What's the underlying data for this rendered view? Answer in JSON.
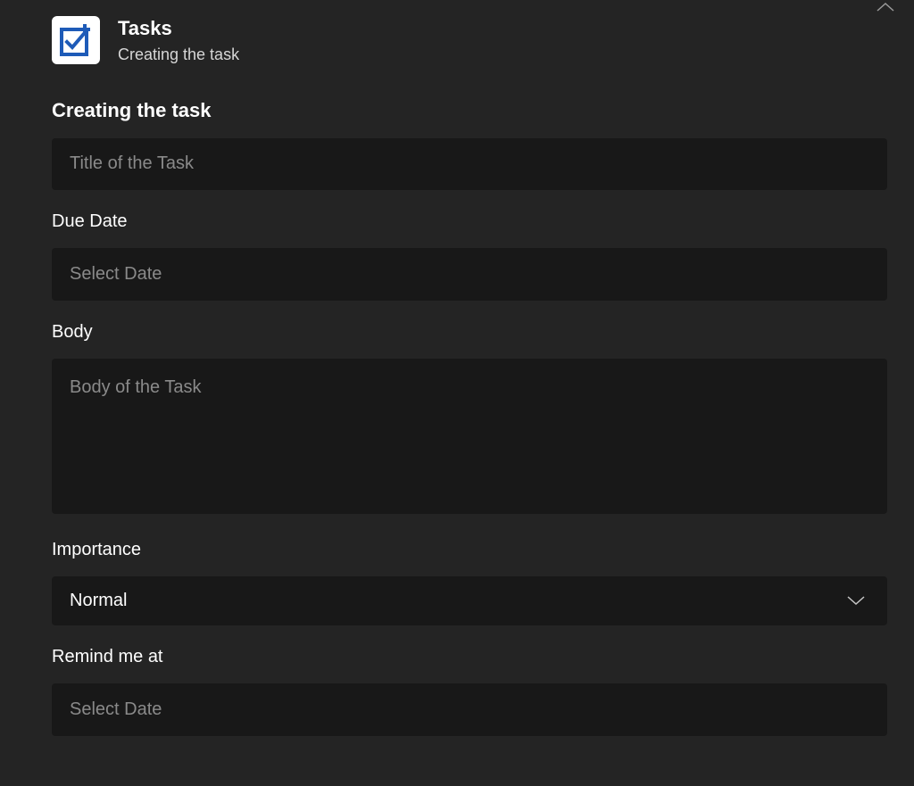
{
  "header": {
    "app_title": "Tasks",
    "app_subtitle": "Creating the task"
  },
  "form": {
    "heading": "Creating the task",
    "title": {
      "placeholder": "Title of the Task",
      "value": ""
    },
    "due_date": {
      "label": "Due Date",
      "placeholder": "Select Date",
      "value": ""
    },
    "body": {
      "label": "Body",
      "placeholder": "Body of the Task",
      "value": ""
    },
    "importance": {
      "label": "Importance",
      "selected": "Normal"
    },
    "remind_me": {
      "label": "Remind me at",
      "placeholder": "Select Date",
      "value": ""
    }
  }
}
